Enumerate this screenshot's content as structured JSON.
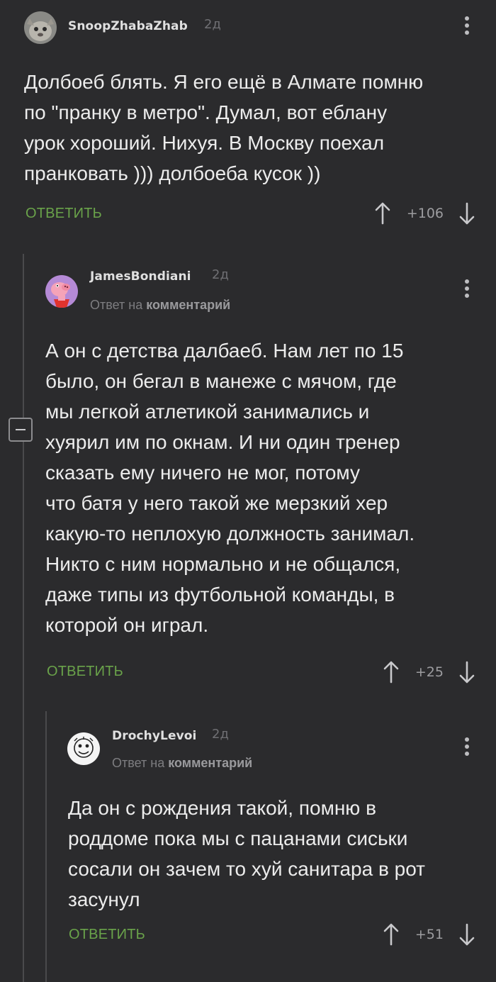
{
  "comments": [
    {
      "username": "SnoopZhabaZhab",
      "time": "2д",
      "text": "Долбоеб блять. Я его ещё в Алмате помню\nпо \"пранку в метро\". Думал, вот еблану\nурок хороший. Нихуя. В Москву поехал\nпранковать ))) долбоеба кусок ))",
      "reply_label": "ОТВЕТИТЬ",
      "score": "+106",
      "avatar_icon": "cat-avatar-icon"
    },
    {
      "username": "JamesBondiani",
      "time": "2д",
      "reply_to_prefix": "Ответ на",
      "reply_to_link": "комментарий",
      "text": "А он с детства далбаеб. Нам лет по 15\nбыло, он бегал в манеже с мячом, где\nмы легкой атлетикой занимались и\nхуярил им по окнам. И ни один тренер\nсказать ему ничего не мог, потому\nчто батя у него такой же мерзкий хер\nкакую-то неплохую должность занимал.\nНикто с ним нормально и не общался,\nдаже типы из футбольной команды, в\nкоторой он играл.",
      "reply_label": "ОТВЕТИТЬ",
      "score": "+25",
      "avatar_icon": "pig-avatar-icon"
    },
    {
      "username": "DrochyLevoi",
      "time": "2д",
      "reply_to_prefix": "Ответ на",
      "reply_to_link": "комментарий",
      "text": "Да он с рождения такой, помню в\nроддоме пока мы с пацанами сиськи\nсосали он зачем то хуй санитара в рот\nзасунул",
      "reply_label": "ОТВЕТИТЬ",
      "score": "+51",
      "avatar_icon": "drawing-avatar-icon"
    }
  ],
  "colors": {
    "background": "#2b2b2d",
    "reply_button": "#6aa34a",
    "thread_line": "#4a4a4c"
  }
}
